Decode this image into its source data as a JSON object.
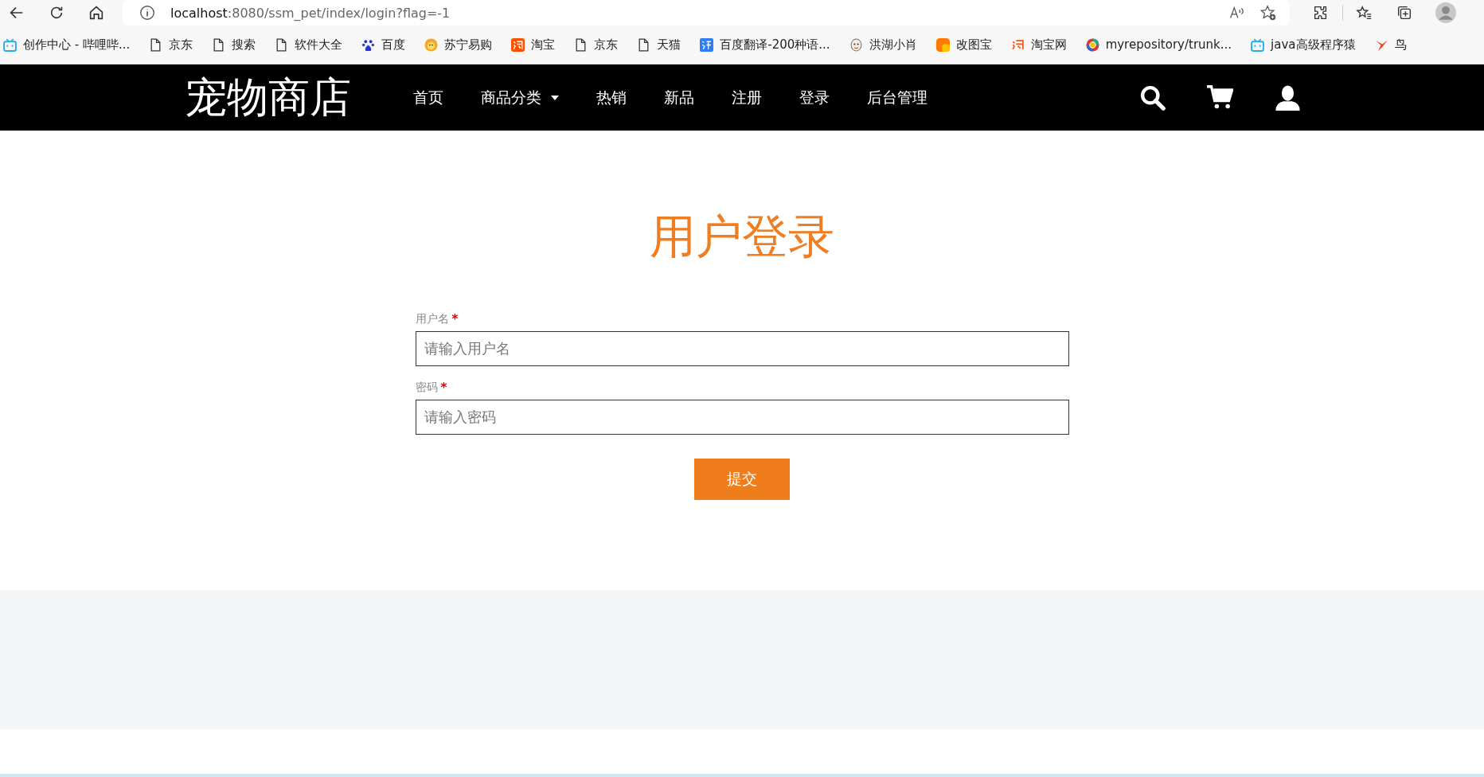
{
  "browser": {
    "url_host": "localhost",
    "url_rest": ":8080/ssm_pet/index/login?flag=-1"
  },
  "bookmarks": [
    {
      "label": "创作中心 - 哔哩哔...",
      "kind": "tv"
    },
    {
      "label": "京东",
      "kind": "page"
    },
    {
      "label": "搜索",
      "kind": "page"
    },
    {
      "label": "软件大全",
      "kind": "page"
    },
    {
      "label": "百度",
      "kind": "paw"
    },
    {
      "label": "苏宁易购",
      "kind": "lion"
    },
    {
      "label": "淘宝",
      "kind": "tao"
    },
    {
      "label": "京东",
      "kind": "page"
    },
    {
      "label": "天猫",
      "kind": "page"
    },
    {
      "label": "百度翻译-200种语...",
      "kind": "translate"
    },
    {
      "label": "洪湖小肖",
      "kind": "mascot"
    },
    {
      "label": "改图宝",
      "kind": "square"
    },
    {
      "label": "淘宝网",
      "kind": "taoword"
    },
    {
      "label": "myrepository/trunk...",
      "kind": "globe"
    },
    {
      "label": "java高级程序猿",
      "kind": "tv"
    },
    {
      "label": "鸟",
      "kind": "bird"
    }
  ],
  "nav": {
    "logo": "宠物商店",
    "items": [
      {
        "label": "首页",
        "dropdown": false
      },
      {
        "label": "商品分类",
        "dropdown": true
      },
      {
        "label": "热销",
        "dropdown": false
      },
      {
        "label": "新品",
        "dropdown": false
      },
      {
        "label": "注册",
        "dropdown": false
      },
      {
        "label": "登录",
        "dropdown": false
      },
      {
        "label": "后台管理",
        "dropdown": false
      }
    ]
  },
  "login": {
    "title": "用户登录",
    "fields": [
      {
        "label": "用户名",
        "required_mark": "*",
        "placeholder": "请输入用户名"
      },
      {
        "label": "密码",
        "required_mark": "*",
        "placeholder": "请输入密码"
      }
    ],
    "submit": "提交"
  }
}
